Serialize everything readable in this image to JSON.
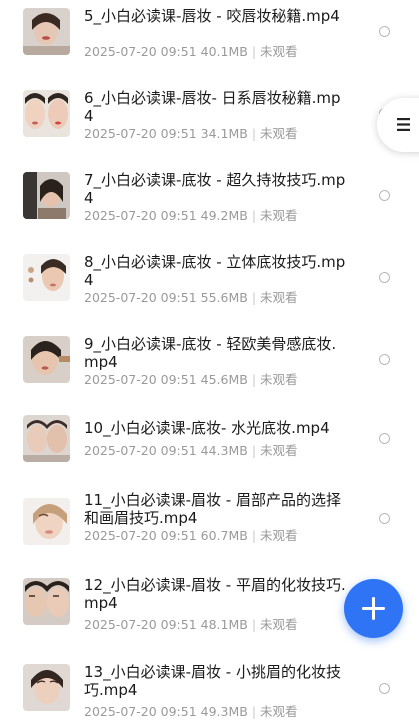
{
  "files": [
    {
      "name": "5_小白必读课-唇妆 - 咬唇妆秘籍.mp4",
      "date": "2025-07-20 09:51",
      "size": "40.1MB",
      "status": "未观看"
    },
    {
      "name": "6_小白必读课-唇妆- 日系唇妆秘籍.mp4",
      "date": "2025-07-20 09:51",
      "size": "34.1MB",
      "status": "未观看"
    },
    {
      "name": "7_小白必读课-底妆 - 超久持妆技巧.mp4",
      "date": "2025-07-20 09:51",
      "size": "49.2MB",
      "status": "未观看"
    },
    {
      "name": "8_小白必读课-底妆 - 立体底妆技巧.mp4",
      "date": "2025-07-20 09:51",
      "size": "55.6MB",
      "status": "未观看"
    },
    {
      "name": "9_小白必读课-底妆 - 轻欧美骨感底妆.mp4",
      "date": "2025-07-20 09:51",
      "size": "45.6MB",
      "status": "未观看"
    },
    {
      "name": "10_小白必读课-底妆- 水光底妆.mp4",
      "date": "2025-07-20 09:51",
      "size": "44.3MB",
      "status": "未观看"
    },
    {
      "name": "11_小白必读课-眉妆 - 眉部产品的选择和画眉技巧.mp4",
      "date": "2025-07-20 09:51",
      "size": "60.7MB",
      "status": "未观看"
    },
    {
      "name": "12_小白必读课-眉妆 - 平眉的化妆技巧.mp4",
      "date": "2025-07-20 09:51",
      "size": "48.1MB",
      "status": "未观看"
    },
    {
      "name": "13_小白必读课-眉妆 - 小挑眉的化妆技巧.mp4",
      "date": "2025-07-20 09:51",
      "size": "49.3MB",
      "status": "未观看"
    }
  ],
  "icons": {
    "side_tab": "menu-lines-icon",
    "fab": "plus-icon",
    "row_select": "radio-circle-icon",
    "thumbnail": "video-thumbnail"
  },
  "colors": {
    "accent": "#2f74f5",
    "text_primary": "#1a1a1a",
    "text_secondary": "#9a9a9a",
    "radio_border": "#b8b8b8"
  }
}
